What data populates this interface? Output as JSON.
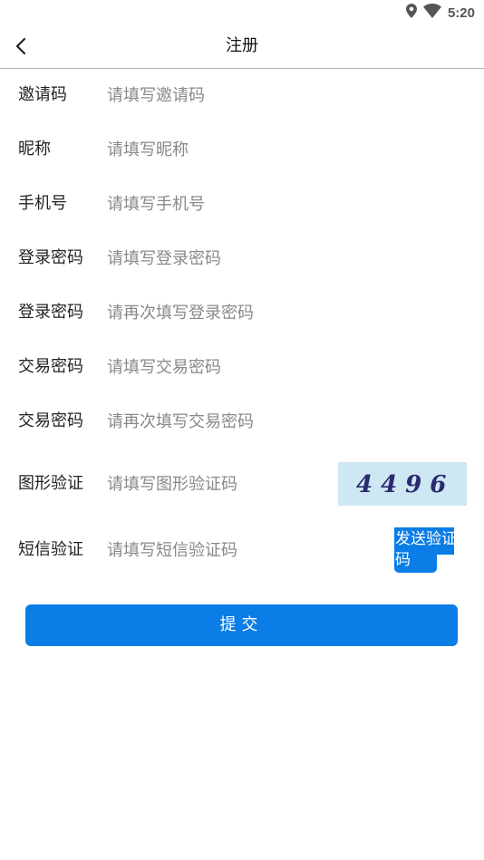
{
  "status_bar": {
    "time": "5:20",
    "icons": [
      "location-icon",
      "wifi-icon"
    ]
  },
  "header": {
    "title": "注册",
    "back_icon": "chevron-left-icon"
  },
  "form": {
    "fields": [
      {
        "label": "邀请码",
        "placeholder": "请填写邀请码",
        "value": ""
      },
      {
        "label": "昵称",
        "placeholder": "请填写昵称",
        "value": ""
      },
      {
        "label": "手机号",
        "placeholder": "请填写手机号",
        "value": ""
      },
      {
        "label": "登录密码",
        "placeholder": "请填写登录密码",
        "value": ""
      },
      {
        "label": "登录密码",
        "placeholder": "请再次填写登录密码",
        "value": ""
      },
      {
        "label": "交易密码",
        "placeholder": "请填写交易密码",
        "value": ""
      },
      {
        "label": "交易密码",
        "placeholder": "请再次填写交易密码",
        "value": ""
      },
      {
        "label": "图形验证",
        "placeholder": "请填写图形验证码",
        "value": ""
      },
      {
        "label": "短信验证",
        "placeholder": "请填写短信验证码",
        "value": ""
      }
    ],
    "captcha_text": "4496",
    "send_code_label": "发送验证码",
    "submit_label": "提交"
  },
  "colors": {
    "accent": "#0a7de6",
    "captcha_bg": "#cde7f3",
    "captcha_text": "#2a2a6e",
    "placeholder": "#888888",
    "divider": "#b3b3b3"
  }
}
